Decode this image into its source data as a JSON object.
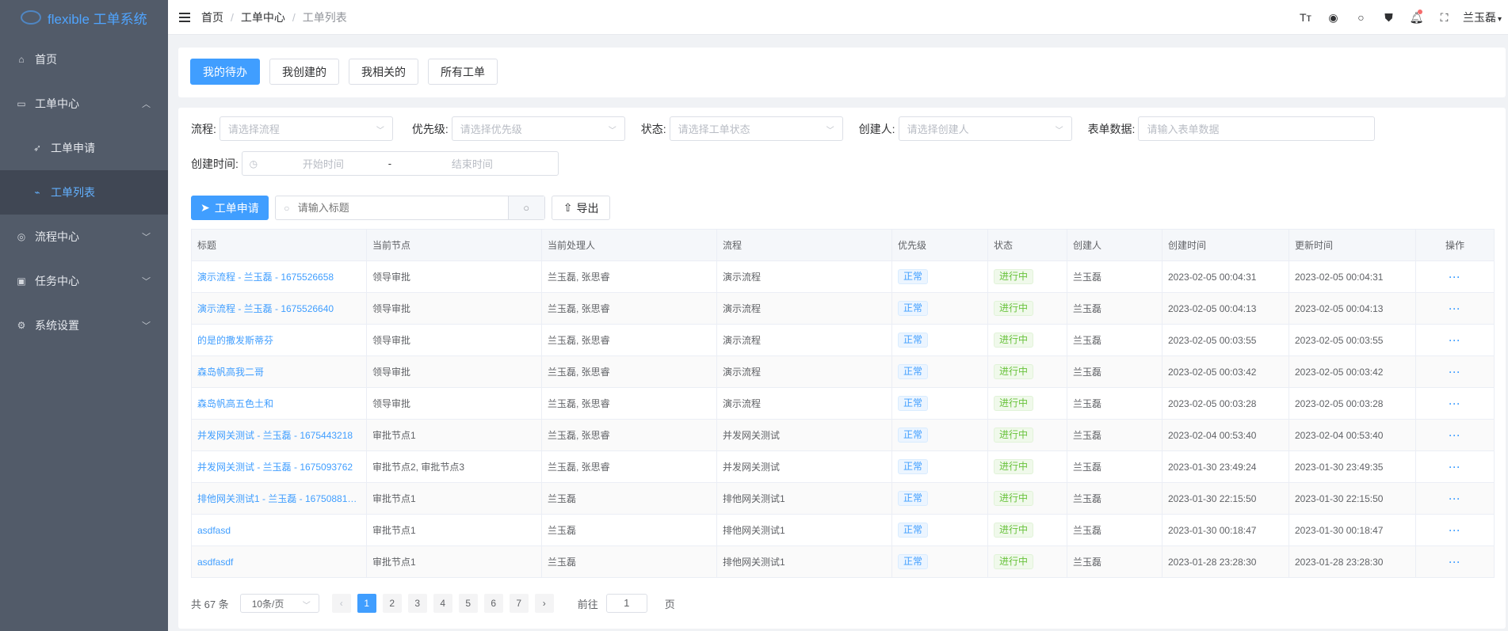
{
  "app": {
    "title": "flexible 工单系统"
  },
  "sidebar": {
    "items": [
      {
        "label": "首页"
      },
      {
        "label": "工单中心"
      },
      {
        "label": "工单申请"
      },
      {
        "label": "工单列表"
      },
      {
        "label": "流程中心"
      },
      {
        "label": "任务中心"
      },
      {
        "label": "系统设置"
      }
    ]
  },
  "header": {
    "breadcrumb": [
      "首页",
      "工单中心",
      "工单列表"
    ],
    "user": "兰玉磊"
  },
  "tabs": [
    "我的待办",
    "我创建的",
    "我相关的",
    "所有工单"
  ],
  "filters": {
    "process_label": "流程:",
    "process_placeholder": "请选择流程",
    "priority_label": "优先级:",
    "priority_placeholder": "请选择优先级",
    "status_label": "状态:",
    "status_placeholder": "请选择工单状态",
    "creator_label": "创建人:",
    "creator_placeholder": "请选择创建人",
    "form_label": "表单数据:",
    "form_placeholder": "请输入表单数据",
    "time_label": "创建时间:",
    "start_placeholder": "开始时间",
    "range_sep": "-",
    "end_placeholder": "结束时间"
  },
  "toolbar": {
    "apply_label": "工单申请",
    "search_placeholder": "请输入标题",
    "export_label": "导出"
  },
  "table": {
    "columns": [
      "标题",
      "当前节点",
      "当前处理人",
      "流程",
      "优先级",
      "状态",
      "创建人",
      "创建时间",
      "更新时间",
      "操作"
    ],
    "rows": [
      {
        "title": "演示流程 - 兰玉磊 - 1675526658",
        "node": "领导审批",
        "handler": "兰玉磊, 张思睿",
        "process": "演示流程",
        "priority": "正常",
        "status": "进行中",
        "creator": "兰玉磊",
        "created": "2023-02-05 00:04:31",
        "updated": "2023-02-05 00:04:31",
        "op": "···"
      },
      {
        "title": "演示流程 - 兰玉磊 - 1675526640",
        "node": "领导审批",
        "handler": "兰玉磊, 张思睿",
        "process": "演示流程",
        "priority": "正常",
        "status": "进行中",
        "creator": "兰玉磊",
        "created": "2023-02-05 00:04:13",
        "updated": "2023-02-05 00:04:13",
        "op": "···"
      },
      {
        "title": "的是的撒发斯蒂芬",
        "node": "领导审批",
        "handler": "兰玉磊, 张思睿",
        "process": "演示流程",
        "priority": "正常",
        "status": "进行中",
        "creator": "兰玉磊",
        "created": "2023-02-05 00:03:55",
        "updated": "2023-02-05 00:03:55",
        "op": "···"
      },
      {
        "title": "森岛帆高我二哥",
        "node": "领导审批",
        "handler": "兰玉磊, 张思睿",
        "process": "演示流程",
        "priority": "正常",
        "status": "进行中",
        "creator": "兰玉磊",
        "created": "2023-02-05 00:03:42",
        "updated": "2023-02-05 00:03:42",
        "op": "···"
      },
      {
        "title": "森岛帆高五色土和",
        "node": "领导审批",
        "handler": "兰玉磊, 张思睿",
        "process": "演示流程",
        "priority": "正常",
        "status": "进行中",
        "creator": "兰玉磊",
        "created": "2023-02-05 00:03:28",
        "updated": "2023-02-05 00:03:28",
        "op": "···"
      },
      {
        "title": "并发网关测试 - 兰玉磊 - 1675443218",
        "node": "审批节点1",
        "handler": "兰玉磊, 张思睿",
        "process": "并发网关测试",
        "priority": "正常",
        "status": "进行中",
        "creator": "兰玉磊",
        "created": "2023-02-04 00:53:40",
        "updated": "2023-02-04 00:53:40",
        "op": "···"
      },
      {
        "title": "并发网关测试 - 兰玉磊 - 1675093762",
        "node": "审批节点2, 审批节点3",
        "handler": "兰玉磊, 张思睿",
        "process": "并发网关测试",
        "priority": "正常",
        "status": "进行中",
        "creator": "兰玉磊",
        "created": "2023-01-30 23:49:24",
        "updated": "2023-01-30 23:49:35",
        "op": "···"
      },
      {
        "title": "排他网关测试1 - 兰玉磊 - 16750881…",
        "node": "审批节点1",
        "handler": "兰玉磊",
        "process": "排他网关测试1",
        "priority": "正常",
        "status": "进行中",
        "creator": "兰玉磊",
        "created": "2023-01-30 22:15:50",
        "updated": "2023-01-30 22:15:50",
        "op": "···"
      },
      {
        "title": "asdfasd",
        "node": "审批节点1",
        "handler": "兰玉磊",
        "process": "排他网关测试1",
        "priority": "正常",
        "status": "进行中",
        "creator": "兰玉磊",
        "created": "2023-01-30 00:18:47",
        "updated": "2023-01-30 00:18:47",
        "op": "···"
      },
      {
        "title": "asdfasdf",
        "node": "审批节点1",
        "handler": "兰玉磊",
        "process": "排他网关测试1",
        "priority": "正常",
        "status": "进行中",
        "creator": "兰玉磊",
        "created": "2023-01-28 23:28:30",
        "updated": "2023-01-28 23:28:30",
        "op": "···"
      }
    ]
  },
  "pagination": {
    "total_text": "共 67 条",
    "page_size": "10条/页",
    "pages": [
      "1",
      "2",
      "3",
      "4",
      "5",
      "6",
      "7"
    ],
    "current": "1",
    "goto_label": "前往",
    "goto_value": "1",
    "page_suffix": "页"
  },
  "colors": {
    "primary": "#409eff",
    "sidebar_bg": "#525b69",
    "sidebar_active_bg": "#404754",
    "success": "#67c23a"
  },
  "icons": {
    "sidebar": [
      "home-icon",
      "document-icon",
      "send-icon",
      "chart-icon",
      "globe-icon",
      "task-icon",
      "gear-icon"
    ],
    "header": [
      "font-size-icon",
      "github-icon",
      "search-icon",
      "shirt-icon",
      "bell-icon",
      "fullscreen-icon"
    ]
  }
}
